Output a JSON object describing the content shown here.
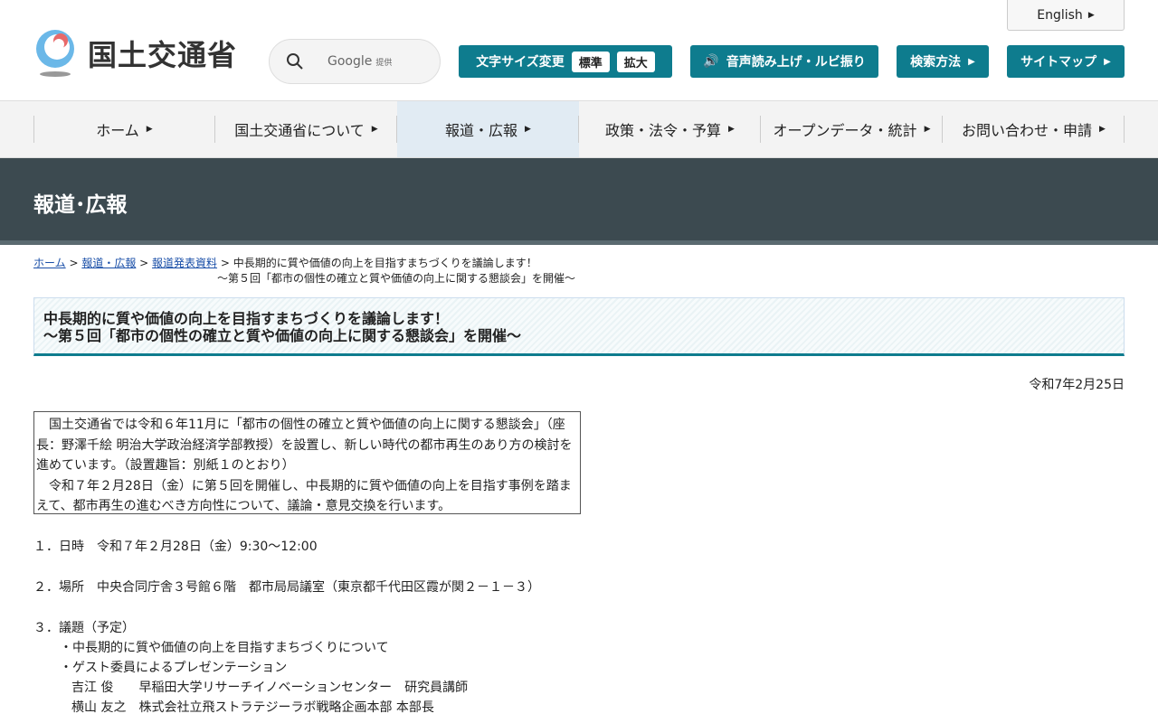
{
  "header": {
    "english": "English",
    "logo_text": "国土交通省",
    "search_brand": "Google",
    "search_provided": "提供",
    "font_size_label": "文字サイズ変更",
    "font_standard": "標準",
    "font_large": "拡大",
    "speech": "音声読み上げ・ルビ振り",
    "search_method": "検索方法",
    "sitemap": "サイトマップ"
  },
  "nav": [
    "ホーム",
    "国土交通省について",
    "報道・広報",
    "政策・法令・予算",
    "オープンデータ・統計",
    "お問い合わせ・申請"
  ],
  "hero_title": "報道･広報",
  "breadcrumb": {
    "home": "ホーム",
    "press": "報道・広報",
    "releases": "報道発表資料",
    "current1": "中長期的に質や価値の向上を目指すまちづくりを議論します！",
    "current2": "～第５回「都市の個性の確立と質や価値の向上に関する懇談会」を開催～"
  },
  "title": {
    "line1": "中長期的に質や価値の向上を目指すまちづくりを議論します！",
    "line2": "～第５回「都市の個性の確立と質や価値の向上に関する懇談会」を開催～"
  },
  "date": "令和7年2月25日",
  "summary": [
    "　国土交通省では令和６年11月に「都市の個性の確立と質や価値の向上に関する懇談会」（座",
    "長：野澤千絵 明治大学政治経済学部教授）を設置し、新しい時代の都市再生のあり方の検討を",
    "進めています。（設置趣旨：別紙１のとおり）",
    "　令和７年２月28日（金）に第５回を開催し、中長期的に質や価値の向上を目指す事例を踏ま",
    "えて、都市再生の進むべき方向性について、議論・意見交換を行います。"
  ],
  "items": {
    "datetime": "１．日時　令和７年２月28日（金）9:30～12:00",
    "place": "２．場所　中央合同庁舎３号館６階　都市局局議室（東京都千代田区霞が関２－１－３）",
    "agenda": "３．議題（予定）",
    "agenda1": "・中長期的に質や価値の向上を目指すまちづくりについて",
    "agenda2": "・ゲスト委員によるプレゼンテーション",
    "guest1": "吉江 俊　　早稲田大学リサーチイノベーションセンター　研究員講師",
    "guest2": "横山 友之　株式会社立飛ストラテジーラボ戦略企画本部 本部長"
  }
}
